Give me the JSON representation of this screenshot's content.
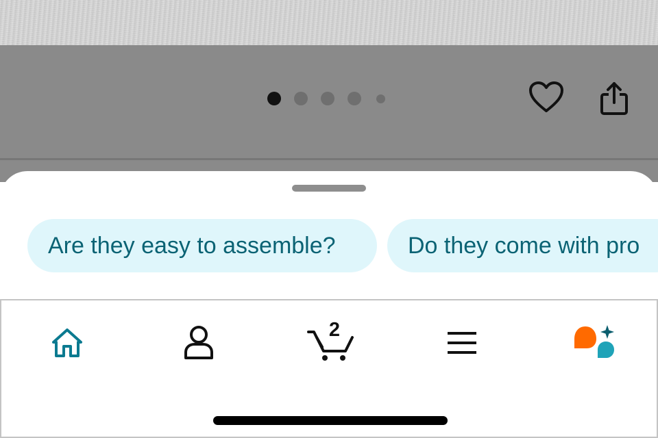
{
  "gallery": {
    "dot_count": 5,
    "active_index": 0
  },
  "actions": {
    "heart_icon": "heart-outline",
    "share_icon": "share-upload"
  },
  "suggestions": [
    {
      "label": "Are they easy to assemble?"
    },
    {
      "label": "Do they come with pro"
    }
  ],
  "nav": {
    "items": [
      {
        "name": "home",
        "icon": "home-icon",
        "active": true
      },
      {
        "name": "account",
        "icon": "person-icon"
      },
      {
        "name": "cart",
        "icon": "cart-icon",
        "badge": "2"
      },
      {
        "name": "menu",
        "icon": "hamburger-icon"
      },
      {
        "name": "rufus",
        "icon": "rufus-ai-icon"
      }
    ]
  },
  "colors": {
    "accent": "#0b7a90",
    "chip_bg": "#dff6fb",
    "chip_text": "#0b6374",
    "rufus_orange": "#ff6a00",
    "rufus_teal": "#1fa3b8",
    "rufus_sparkle": "#0b5e6e",
    "overlay": "#8a8a8a"
  }
}
